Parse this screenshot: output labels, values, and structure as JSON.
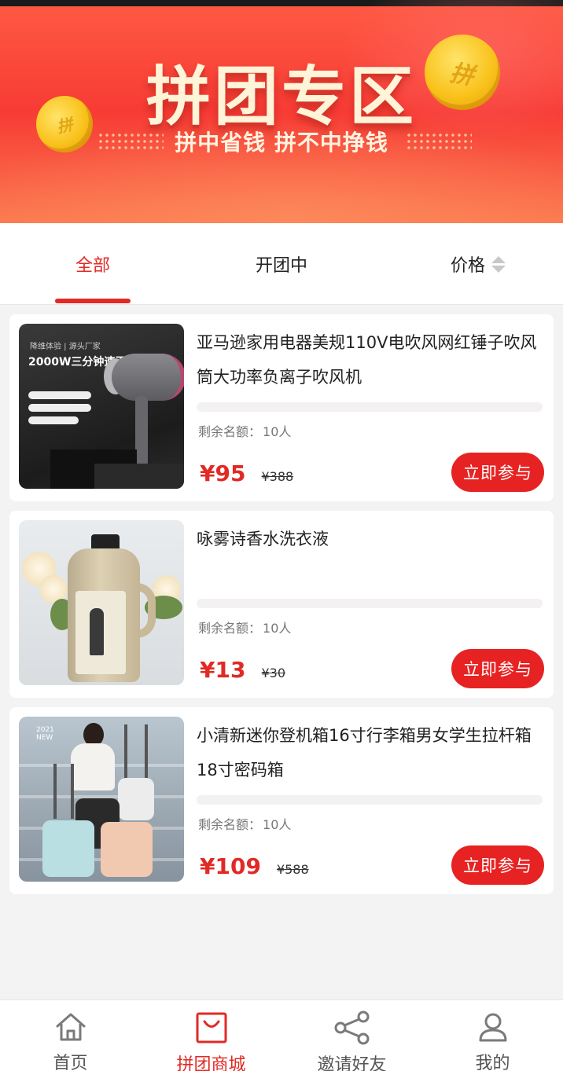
{
  "banner": {
    "title": "拼团专区",
    "subtitle": "拼中省钱 拼不中挣钱",
    "coin_text_left": "拼",
    "coin_text_right": "拼"
  },
  "tabs": [
    {
      "label": "全部",
      "active": true
    },
    {
      "label": "开团中",
      "active": false
    },
    {
      "label": "价格",
      "active": false
    }
  ],
  "products": [
    {
      "title": "亚马逊家用电器美规110V电吹风网红锤子吹风筒大功率负离子吹风机",
      "remaining_label": "剩余名额：",
      "remaining_value": "10人",
      "price": "¥95",
      "original_price": "¥388",
      "button": "立即参与",
      "image": {
        "line1": "降维体验 | 源头厂家",
        "line2": "2000W三分钟速干"
      }
    },
    {
      "title": "咏雾诗香水洗衣液",
      "remaining_label": "剩余名额：",
      "remaining_value": "10人",
      "price": "¥13",
      "original_price": "¥30",
      "button": "立即参与"
    },
    {
      "title": "小清新迷你登机箱16寸行李箱男女学生拉杆箱18寸密码箱",
      "remaining_label": "剩余名额：",
      "remaining_value": "10人",
      "price": "¥109",
      "original_price": "¥588",
      "button": "立即参与",
      "image": {
        "year": "2021",
        "tag": "NEW"
      }
    }
  ],
  "bottom_nav": [
    {
      "label": "首页",
      "icon": "home-icon",
      "active": false
    },
    {
      "label": "拼团商城",
      "icon": "shopping-bag-icon",
      "active": true
    },
    {
      "label": "邀请好友",
      "icon": "share-icon",
      "active": false
    },
    {
      "label": "我的",
      "icon": "user-icon",
      "active": false
    }
  ],
  "colors": {
    "accent": "#e12a25",
    "button": "#e62322",
    "banner_top": "#ff5a43",
    "background": "#f3f3f3"
  }
}
